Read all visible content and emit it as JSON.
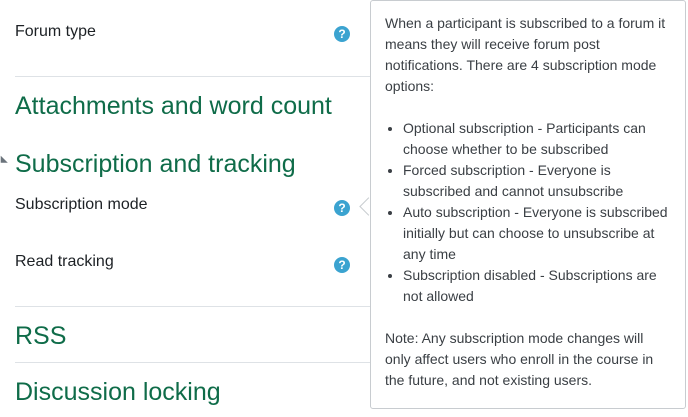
{
  "form": {
    "forum_type_label": "Forum type",
    "subscription_mode_label": "Subscription mode",
    "read_tracking_label": "Read tracking",
    "help_icon_glyph": "?"
  },
  "sections": {
    "attachments": "Attachments and word count",
    "subscription": "Subscription and tracking",
    "rss": "RSS",
    "discussion_locking": "Discussion locking"
  },
  "popover": {
    "intro": "When a participant is subscribed to a forum it means they will receive forum post notifications. There are 4 subscription mode options:",
    "options": [
      "Optional subscription - Participants can choose whether to be subscribed",
      "Forced subscription - Everyone is subscribed and cannot unsubscribe",
      "Auto subscription - Everyone is subscribed initially but can choose to unsubscribe at any time",
      "Subscription disabled - Subscriptions are not allowed"
    ],
    "note": "Note: Any subscription mode changes will only affect users who enroll in the course in the future, and not existing users."
  },
  "colors": {
    "section_title": "#0f6c49",
    "help_icon": "#3ba3d0",
    "divider": "#dee2e6"
  },
  "icons": {
    "help": "question-circle-icon",
    "collapse": "chevron-down-icon"
  }
}
